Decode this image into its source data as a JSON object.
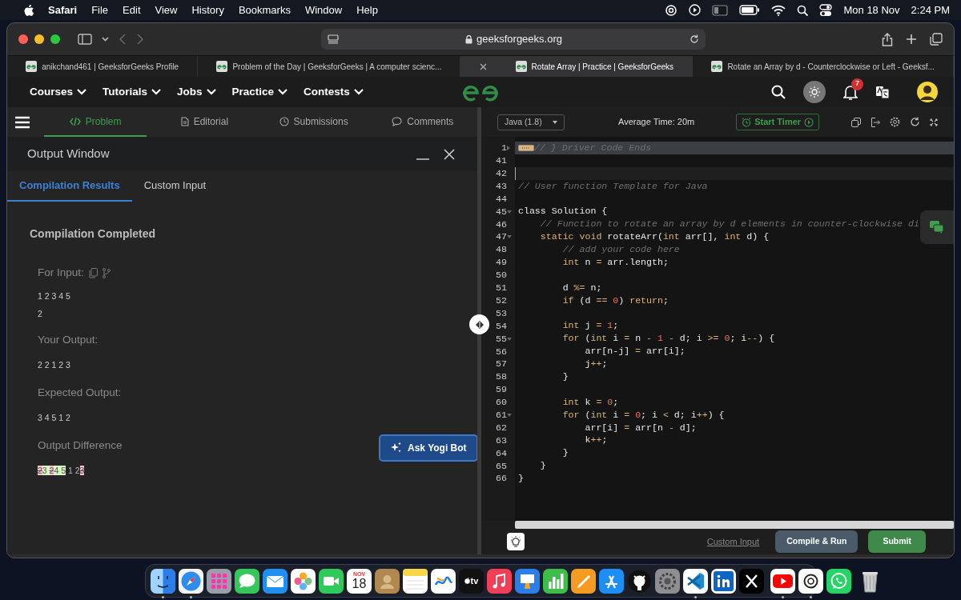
{
  "menu_bar": {
    "app": "Safari",
    "items": [
      "File",
      "Edit",
      "View",
      "History",
      "Bookmarks",
      "Window",
      "Help"
    ],
    "date": "Mon 18 Nov",
    "time": "2:24 PM"
  },
  "browser": {
    "address": "geeksforgeeks.org",
    "tabs": [
      {
        "title": "anikchand461 | GeeksforGeeks Profile",
        "selected": false
      },
      {
        "title": "Problem of the Day | GeeksforGeeks | A computer scienc...",
        "selected": false
      },
      {
        "title": "Rotate Array | Practice | GeeksforGeeks",
        "selected": true
      },
      {
        "title": "Rotate an Array by d - Counterclockwise or Left - Geeksf...",
        "selected": false
      }
    ]
  },
  "site_nav": {
    "items": [
      "Courses",
      "Tutorials",
      "Jobs",
      "Practice",
      "Contests"
    ],
    "notification_count": "7"
  },
  "problem_tabs": [
    {
      "label": "Problem",
      "kind": "code",
      "selected": true
    },
    {
      "label": "Editorial",
      "kind": "document",
      "selected": false
    },
    {
      "label": "Submissions",
      "kind": "clock",
      "selected": false
    },
    {
      "label": "Comments",
      "kind": "comment",
      "selected": false
    }
  ],
  "output_window": {
    "title": "Output Window",
    "tabs": [
      {
        "label": "Compilation Results",
        "selected": true
      },
      {
        "label": "Custom Input",
        "selected": false
      }
    ],
    "status": "Compilation Completed",
    "input_label": "For Input:",
    "input_lines": [
      "1 2 3 4 5",
      "2"
    ],
    "your_output_label": "Your Output:",
    "your_output": "2 2 1 2 3",
    "expected_label": "Expected Output:",
    "expected_output": "3 4 5 1 2",
    "difference_label": "Output Difference",
    "difference": [
      {
        "text": "2",
        "kind": "removed"
      },
      {
        "text": "3 ",
        "kind": "added"
      },
      {
        "text": "2",
        "kind": "removed"
      },
      {
        "text": "4 5",
        "kind": "added"
      },
      {
        "text": " 1 2",
        "kind": "plain"
      },
      {
        "text": "3",
        "kind": "removed"
      }
    ],
    "ask_button": "Ask Yogi Bot"
  },
  "editor": {
    "language": "Java (1.8)",
    "average_time": "Average Time: 20m",
    "timer_button": "Start Timer",
    "lines": [
      {
        "number": "1",
        "collapsed": true,
        "highlighted": true,
        "tokens": [
          {
            "text": "// } Driver Code Ends",
            "kind": "comment"
          }
        ]
      },
      {
        "number": "41"
      },
      {
        "number": "42",
        "current": true
      },
      {
        "number": "43",
        "tokens": [
          {
            "text": "// User function Template for Java",
            "kind": "comment"
          }
        ]
      },
      {
        "number": "44"
      },
      {
        "number": "45",
        "collapsed": false,
        "tokens": [
          {
            "text": "class Solution {",
            "kind": "plain"
          }
        ]
      },
      {
        "number": "46",
        "tokens": [
          {
            "text": "    // Function to rotate an array by d elements in counter-clockwise di",
            "kind": "comment"
          }
        ]
      },
      {
        "number": "47",
        "collapsed": false,
        "tokens": [
          {
            "text": "    static void",
            "kind": "keyword"
          },
          {
            "text": " rotateArr(",
            "kind": "plain"
          },
          {
            "text": "int",
            "kind": "keyword"
          },
          {
            "text": " arr[], ",
            "kind": "plain"
          },
          {
            "text": "int",
            "kind": "keyword"
          },
          {
            "text": " d) {",
            "kind": "plain"
          }
        ]
      },
      {
        "number": "48",
        "tokens": [
          {
            "text": "        // add your code here",
            "kind": "comment"
          }
        ]
      },
      {
        "number": "49",
        "tokens": [
          {
            "text": "        int",
            "kind": "keyword"
          },
          {
            "text": " n ",
            "kind": "plain"
          },
          {
            "text": "=",
            "kind": "operator"
          },
          {
            "text": " arr.length;",
            "kind": "plain"
          }
        ]
      },
      {
        "number": "50"
      },
      {
        "number": "51",
        "tokens": [
          {
            "text": "        d ",
            "kind": "plain"
          },
          {
            "text": "%=",
            "kind": "operator"
          },
          {
            "text": " n;",
            "kind": "plain"
          }
        ]
      },
      {
        "number": "52",
        "tokens": [
          {
            "text": "        if",
            "kind": "keyword"
          },
          {
            "text": " (d ",
            "kind": "plain"
          },
          {
            "text": "==",
            "kind": "operator"
          },
          {
            "text": " 0",
            "kind": "number"
          },
          {
            "text": ") ",
            "kind": "plain"
          },
          {
            "text": "return",
            "kind": "keyword"
          },
          {
            "text": ";",
            "kind": "plain"
          }
        ]
      },
      {
        "number": "53"
      },
      {
        "number": "54",
        "tokens": [
          {
            "text": "        int",
            "kind": "keyword"
          },
          {
            "text": " j ",
            "kind": "plain"
          },
          {
            "text": "=",
            "kind": "operator"
          },
          {
            "text": " 1",
            "kind": "number"
          },
          {
            "text": ";",
            "kind": "plain"
          }
        ]
      },
      {
        "number": "55",
        "collapsed": false,
        "tokens": [
          {
            "text": "        for",
            "kind": "keyword"
          },
          {
            "text": " (",
            "kind": "plain"
          },
          {
            "text": "int",
            "kind": "keyword"
          },
          {
            "text": " i ",
            "kind": "plain"
          },
          {
            "text": "=",
            "kind": "operator"
          },
          {
            "text": " n ",
            "kind": "plain"
          },
          {
            "text": "-",
            "kind": "operator"
          },
          {
            "text": " 1",
            "kind": "number"
          },
          {
            "text": " -",
            "kind": "operator"
          },
          {
            "text": " d; i ",
            "kind": "plain"
          },
          {
            "text": ">=",
            "kind": "operator"
          },
          {
            "text": " 0",
            "kind": "number"
          },
          {
            "text": "; i",
            "kind": "plain"
          },
          {
            "text": "--",
            "kind": "operator"
          },
          {
            "text": ") {",
            "kind": "plain"
          }
        ]
      },
      {
        "number": "56",
        "tokens": [
          {
            "text": "            arr[n-j] ",
            "kind": "plain"
          },
          {
            "text": "=",
            "kind": "operator"
          },
          {
            "text": " arr[i];",
            "kind": "plain"
          }
        ]
      },
      {
        "number": "57",
        "tokens": [
          {
            "text": "            j",
            "kind": "plain"
          },
          {
            "text": "++",
            "kind": "operator"
          },
          {
            "text": ";",
            "kind": "plain"
          }
        ]
      },
      {
        "number": "58",
        "tokens": [
          {
            "text": "        }",
            "kind": "plain"
          }
        ]
      },
      {
        "number": "59"
      },
      {
        "number": "60",
        "tokens": [
          {
            "text": "        int",
            "kind": "keyword"
          },
          {
            "text": " k ",
            "kind": "plain"
          },
          {
            "text": "=",
            "kind": "operator"
          },
          {
            "text": " 0",
            "kind": "number"
          },
          {
            "text": ";",
            "kind": "plain"
          }
        ]
      },
      {
        "number": "61",
        "collapsed": false,
        "tokens": [
          {
            "text": "        for",
            "kind": "keyword"
          },
          {
            "text": " (",
            "kind": "plain"
          },
          {
            "text": "int",
            "kind": "keyword"
          },
          {
            "text": " i ",
            "kind": "plain"
          },
          {
            "text": "=",
            "kind": "operator"
          },
          {
            "text": " 0",
            "kind": "number"
          },
          {
            "text": "; i ",
            "kind": "plain"
          },
          {
            "text": "<",
            "kind": "operator"
          },
          {
            "text": " d; i",
            "kind": "plain"
          },
          {
            "text": "++",
            "kind": "operator"
          },
          {
            "text": ") {",
            "kind": "plain"
          }
        ]
      },
      {
        "number": "62",
        "tokens": [
          {
            "text": "            arr[i] ",
            "kind": "plain"
          },
          {
            "text": "=",
            "kind": "operator"
          },
          {
            "text": " arr[n ",
            "kind": "plain"
          },
          {
            "text": "-",
            "kind": "operator"
          },
          {
            "text": " d];",
            "kind": "plain"
          }
        ]
      },
      {
        "number": "63",
        "tokens": [
          {
            "text": "            k",
            "kind": "plain"
          },
          {
            "text": "++",
            "kind": "operator"
          },
          {
            "text": ";",
            "kind": "plain"
          }
        ]
      },
      {
        "number": "64",
        "tokens": [
          {
            "text": "        }",
            "kind": "plain"
          }
        ]
      },
      {
        "number": "65",
        "tokens": [
          {
            "text": "    }",
            "kind": "plain"
          }
        ]
      },
      {
        "number": "66",
        "tokens": [
          {
            "text": "}",
            "kind": "plain"
          }
        ]
      }
    ]
  },
  "editor_footer": {
    "custom_input": "Custom Input",
    "compile_button": "Compile & Run",
    "submit_button": "Submit"
  },
  "dock": [
    {
      "kind": "finder",
      "running": true
    },
    {
      "kind": "safari",
      "running": true
    },
    {
      "kind": "launchpad",
      "running": false
    },
    {
      "kind": "messages",
      "running": false
    },
    {
      "kind": "mail",
      "running": false
    },
    {
      "kind": "photos",
      "running": false
    },
    {
      "kind": "facetime",
      "running": false
    },
    {
      "kind": "calendar",
      "month": "NOV",
      "day": "18",
      "running": false
    },
    {
      "kind": "contacts",
      "running": false
    },
    {
      "kind": "notes",
      "running": false
    },
    {
      "kind": "freeform",
      "running": false
    },
    {
      "kind": "tv",
      "label": "tv",
      "running": false
    },
    {
      "kind": "music",
      "running": false
    },
    {
      "kind": "keynote",
      "running": false
    },
    {
      "kind": "numbers",
      "running": false
    },
    {
      "kind": "pages",
      "running": false
    },
    {
      "kind": "appstore",
      "running": false
    },
    {
      "kind": "github",
      "running": false
    },
    {
      "kind": "settings",
      "running": false
    },
    {
      "kind": "vscode",
      "running": true
    },
    {
      "kind": "linkedin",
      "running": false
    },
    {
      "kind": "x",
      "running": false
    },
    {
      "kind": "separator"
    },
    {
      "kind": "youtube",
      "running": true
    },
    {
      "kind": "chatgpt",
      "running": true
    },
    {
      "kind": "whatsapp",
      "running": false
    },
    {
      "kind": "separator"
    },
    {
      "kind": "trash",
      "running": false
    }
  ]
}
